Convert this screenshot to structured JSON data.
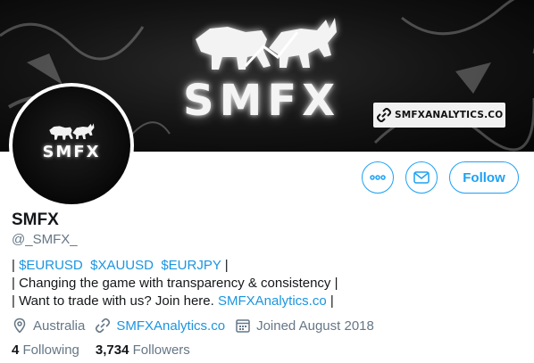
{
  "banner": {
    "wordmark": "SMFX",
    "url_badge": "SMFXANALYTICS.CO"
  },
  "avatar": {
    "wordmark": "SMFX"
  },
  "actions": {
    "more_icon": "more-dots-icon",
    "message_icon": "envelope-icon",
    "follow_label": "Follow",
    "accent": "#1da1f2"
  },
  "profile": {
    "name": "SMFX",
    "handle": "@_SMFX_",
    "bio": {
      "line1": {
        "prefix": "| ",
        "tags": [
          "$EURUSD",
          "$XAUUSD",
          "$EURJPY"
        ],
        "suffix": " |"
      },
      "line2": "| Changing the game with transparency & consistency |",
      "line3": {
        "prefix": "| Want to trade with us? Join here. ",
        "link": "SMFXAnalytics.co",
        "suffix": " |"
      }
    },
    "location": "Australia",
    "website": "SMFXAnalytics.co",
    "joined": "Joined August 2018"
  },
  "stats": {
    "following_count": "4",
    "following_label": "Following",
    "followers_count": "3,734",
    "followers_label": "Followers"
  },
  "colors": {
    "link": "#1b95e0",
    "secondary_text": "#657786",
    "primary_text": "#14171a"
  }
}
